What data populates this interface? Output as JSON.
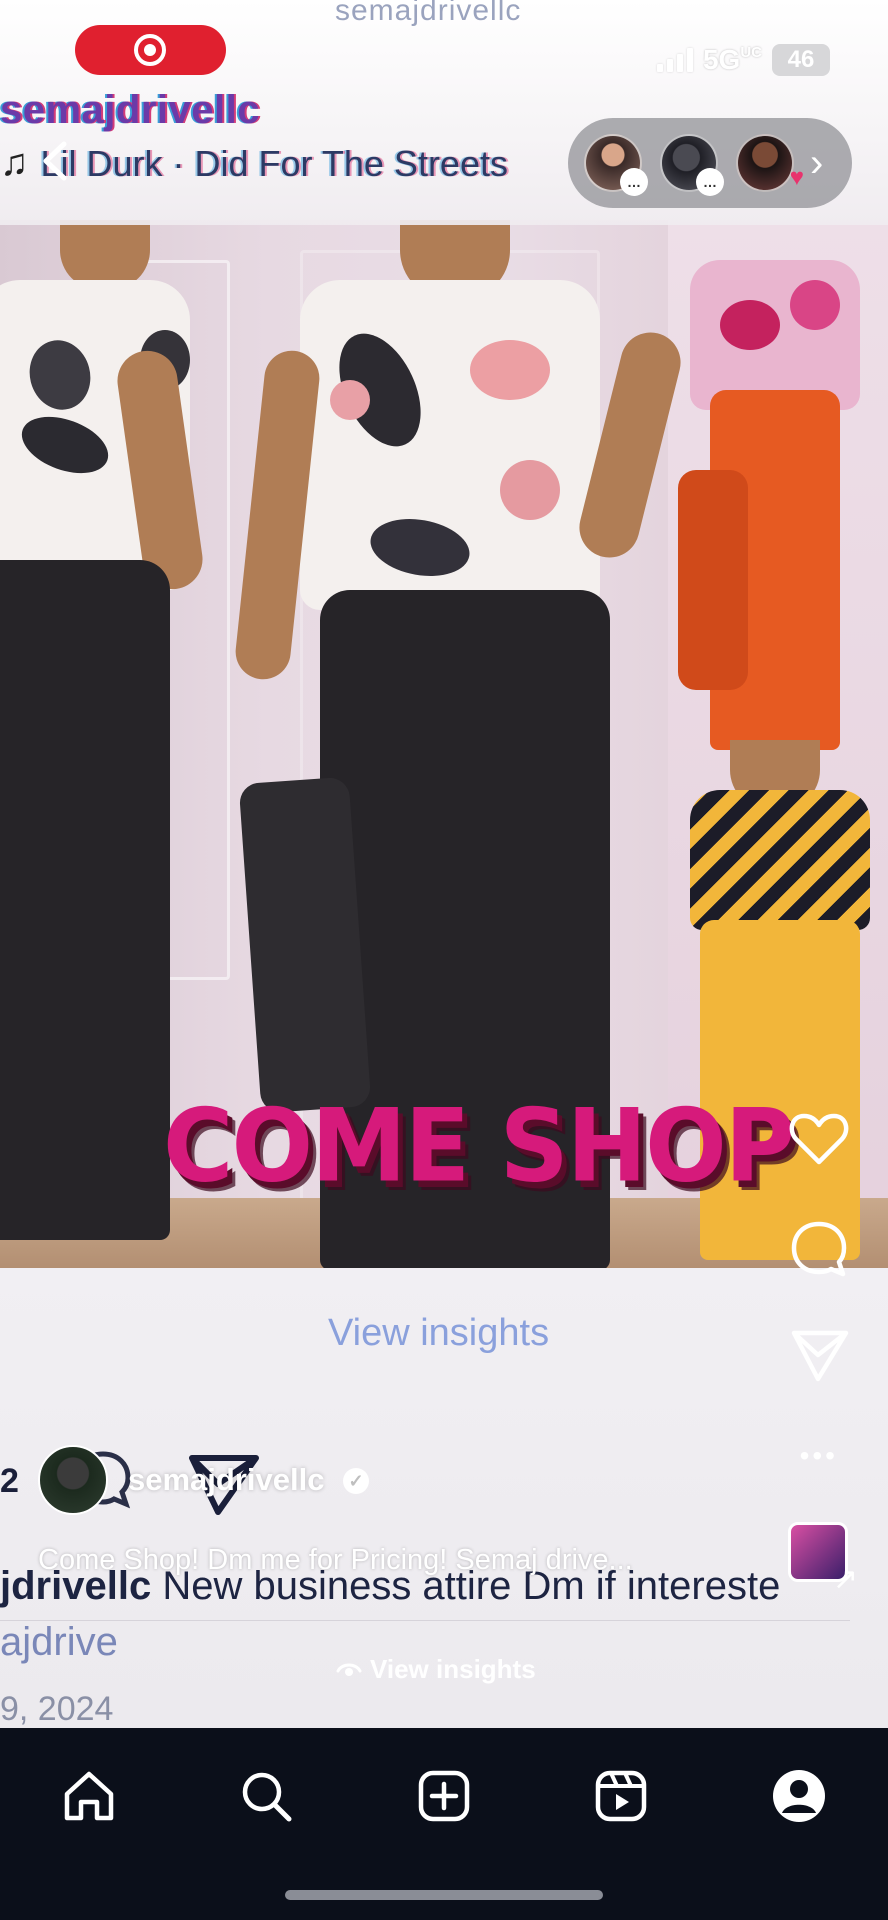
{
  "status_bar": {
    "overlay_username": "semajdrivellc",
    "network": "5G",
    "network_sub": "UC",
    "battery": "46"
  },
  "story_header": {
    "username": "semajdrivellc",
    "music_icon": "music-note-icon",
    "song": "Lil Durk · Did For The Streets",
    "back_icon": "chevron-left-icon",
    "next_icon": "chevron-right-icon"
  },
  "story_tray": {
    "badges": [
      "…",
      "…"
    ],
    "heart": "♥"
  },
  "overlay": {
    "headline": "COME SHOP"
  },
  "actions": {
    "like": "heart-icon",
    "comment": "comment-icon",
    "share": "send-icon",
    "more": "•••"
  },
  "post": {
    "insights_ghost": "View insights",
    "count": "2",
    "username": "semajdrivellc",
    "reel_caption": "Come Shop! Dm me for Pricing! Semaj drive...",
    "caption_user": "jdrivellc",
    "caption_text": " New business attire Dm if intereste",
    "tag": "ajdrive",
    "date": "9, 2024",
    "insights_button": "View insights"
  },
  "nav": {
    "items": [
      "home-icon",
      "search-icon",
      "create-icon",
      "reels-icon",
      "profile-icon"
    ]
  },
  "colors": {
    "accent_pink": "#d61a7b",
    "record_red": "#e0202f",
    "nav_bg": "#0b0f1a"
  }
}
